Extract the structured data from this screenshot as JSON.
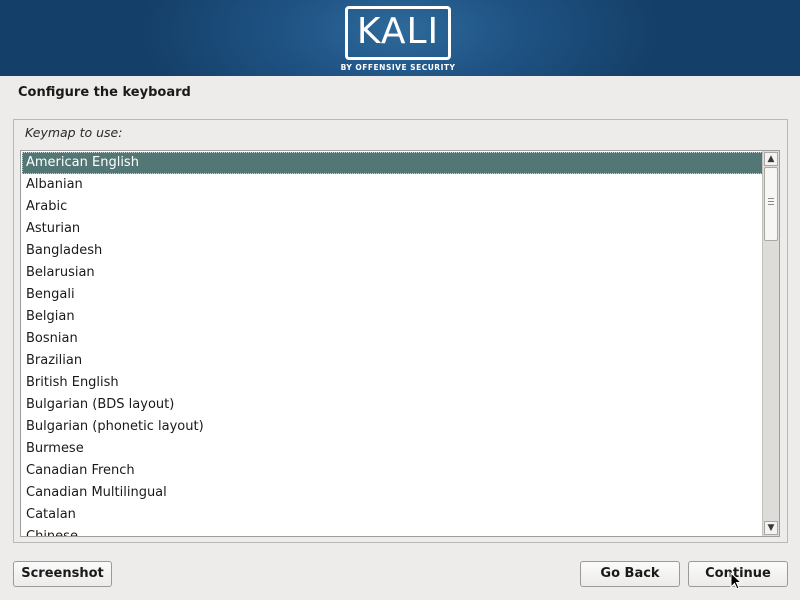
{
  "banner": {
    "logo_text": "KALI",
    "logo_subtitle": "BY OFFENSIVE SECURITY"
  },
  "page": {
    "title": "Configure the keyboard",
    "prompt": "Keymap to use:"
  },
  "keymaps": [
    "American English",
    "Albanian",
    "Arabic",
    "Asturian",
    "Bangladesh",
    "Belarusian",
    "Bengali",
    "Belgian",
    "Bosnian",
    "Brazilian",
    "British English",
    "Bulgarian (BDS layout)",
    "Bulgarian (phonetic layout)",
    "Burmese",
    "Canadian French",
    "Canadian Multilingual",
    "Catalan",
    "Chinese"
  ],
  "selected_keymap": "American English",
  "buttons": {
    "screenshot": "Screenshot",
    "go_back": "Go Back",
    "continue": "Continue"
  },
  "colors": {
    "selection": "#527775",
    "banner": "#1f5384",
    "background": "#edeceb"
  },
  "icons": {
    "scroll_up": "arrow-up-icon",
    "scroll_down": "arrow-down-icon",
    "pointer": "mouse-pointer-icon"
  }
}
